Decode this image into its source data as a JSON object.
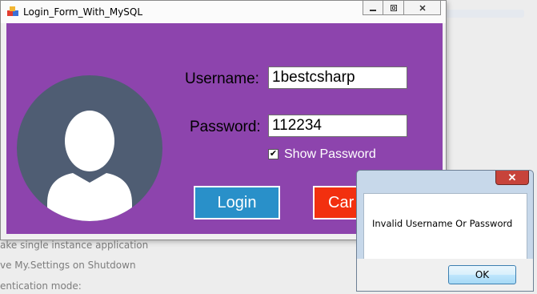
{
  "background": {
    "lines": [
      "ake single instance application",
      "ve My.Settings on Shutdown",
      "entication mode:"
    ]
  },
  "window": {
    "title": "Login_Form_With_MySQL",
    "controls": {
      "minimize_icon": "minimize-icon",
      "restore_icon": "restore-icon",
      "close_icon": "close-icon"
    }
  },
  "form": {
    "background_color": "#8d44ad",
    "username_label": "Username:",
    "username_value": "1bestcsharp",
    "password_label": "Password:",
    "password_value": "112234",
    "show_password_label": "Show Password",
    "show_password_checked": true,
    "login_button": "Login",
    "cancel_button": "Car"
  },
  "message_box": {
    "text": "Invalid Username Or Password",
    "ok_button": "OK"
  }
}
